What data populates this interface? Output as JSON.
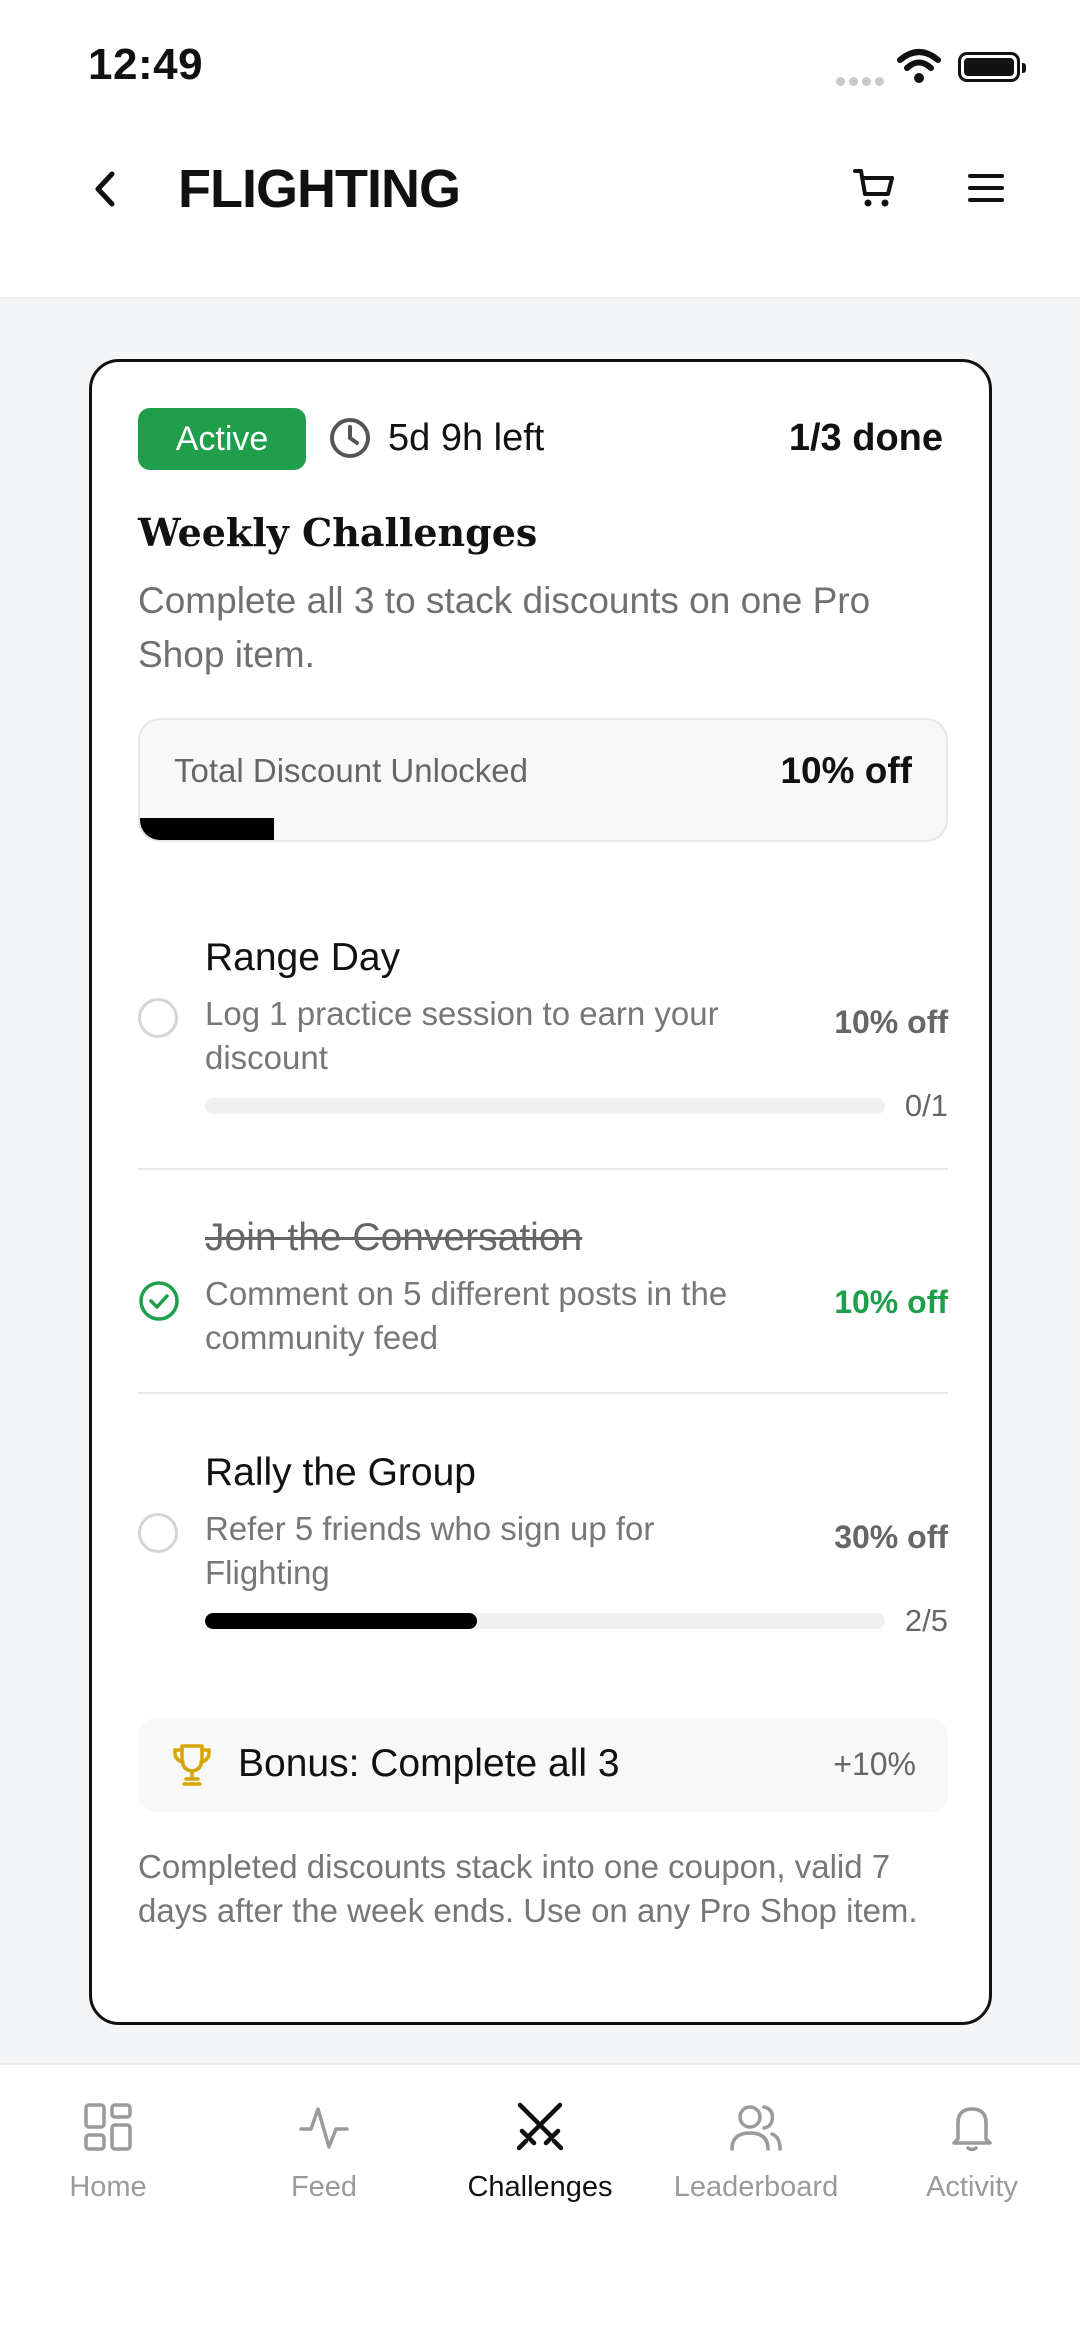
{
  "status_bar": {
    "time": "12:49"
  },
  "header": {
    "title": "FLIGHTING"
  },
  "challenge": {
    "status_badge": "Active",
    "time_left": "5d 9h left",
    "progress_text": "1/3 done",
    "title": "Weekly Challenges",
    "subtitle": "Complete all 3 to stack discounts on one Pro Shop item.",
    "total_discount": {
      "label": "Total Discount Unlocked",
      "value": "10% off",
      "progress_fraction": 0.166
    },
    "items": [
      {
        "title": "Range Day",
        "description": "Log 1 practice session to earn your discount",
        "reward": "10% off",
        "completed": false,
        "progress_text": "0/1",
        "progress_fraction": 0
      },
      {
        "title": "Join the Conversation",
        "description": "Comment on 5 different posts in the community feed",
        "reward": "10% off",
        "completed": true
      },
      {
        "title": "Rally the Group",
        "description": "Refer 5 friends who sign up for Flighting",
        "reward": "30% off",
        "completed": false,
        "progress_text": "2/5",
        "progress_fraction": 0.4
      }
    ],
    "bonus": {
      "label": "Bonus: Complete all 3",
      "value": "+10%"
    },
    "footnote": "Completed discounts stack into one coupon, valid 7 days after the week ends. Use on any Pro Shop item."
  },
  "tabs": [
    {
      "label": "Home",
      "icon": "grid-icon",
      "active": false
    },
    {
      "label": "Feed",
      "icon": "activity-pulse-icon",
      "active": false
    },
    {
      "label": "Challenges",
      "icon": "crossed-swords-icon",
      "active": true
    },
    {
      "label": "Leaderboard",
      "icon": "users-icon",
      "active": false
    },
    {
      "label": "Activity",
      "icon": "bell-icon",
      "active": false
    }
  ],
  "colors": {
    "accent_green": "#1f9e4b",
    "trophy_gold": "#d8a500",
    "text_primary": "#111111",
    "text_muted": "#777777"
  }
}
